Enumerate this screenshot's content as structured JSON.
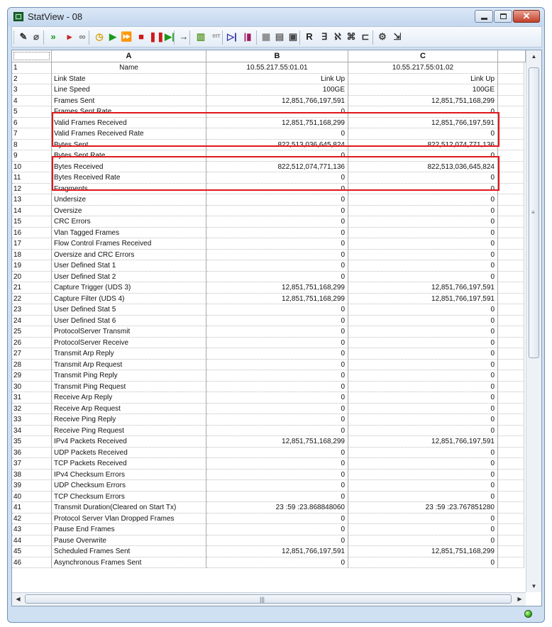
{
  "window": {
    "title": "StatView - 08"
  },
  "colors": {
    "highlight": "#e0181c",
    "status_ok": "#34b01a"
  },
  "toolbar_icons": [
    "pencil-icon",
    "eraser-icon",
    "run-all-icon",
    "play-small-icon",
    "binoculars-icon",
    "clock-icon",
    "play-icon",
    "fast-forward-icon",
    "stop-icon",
    "pause-icon",
    "step-icon",
    "arrow-icon",
    "chart-icon",
    "error-icon",
    "start-capture-icon",
    "stop-capture-icon",
    "grid-icon",
    "properties-icon",
    "properties-edit-icon",
    "reset-icon",
    "link-icon",
    "network-icon",
    "tree-icon",
    "expand-icon",
    "settings-icon",
    "export-icon"
  ],
  "grid": {
    "columns": [
      "A",
      "B",
      "C"
    ],
    "rows": [
      {
        "n": "1",
        "name": "Name",
        "b": "10.55.217.55:01.01",
        "c": "10.55.217.55:01.02"
      },
      {
        "n": "2",
        "name": "Link State",
        "b": "Link Up",
        "c": "Link Up"
      },
      {
        "n": "3",
        "name": "Line Speed",
        "b": "100GE",
        "c": "100GE"
      },
      {
        "n": "4",
        "name": "Frames Sent",
        "b": "12,851,766,197,591",
        "c": "12,851,751,168,299"
      },
      {
        "n": "5",
        "name": "Frames Sent Rate",
        "b": "0",
        "c": "0"
      },
      {
        "n": "6",
        "name": "Valid Frames Received",
        "b": "12,851,751,168,299",
        "c": "12,851,766,197,591"
      },
      {
        "n": "7",
        "name": "Valid Frames Received Rate",
        "b": "0",
        "c": "0"
      },
      {
        "n": "8",
        "name": "Bytes Sent",
        "b": "822,513,036,645,824",
        "c": "822,512,074,771,136"
      },
      {
        "n": "9",
        "name": "Bytes Sent Rate",
        "b": "0",
        "c": "0"
      },
      {
        "n": "10",
        "name": "Bytes Received",
        "b": "822,512,074,771,136",
        "c": "822,513,036,645,824"
      },
      {
        "n": "11",
        "name": "Bytes Received Rate",
        "b": "0",
        "c": "0"
      },
      {
        "n": "12",
        "name": "Fragments",
        "b": "0",
        "c": "0"
      },
      {
        "n": "13",
        "name": "Undersize",
        "b": "0",
        "c": "0"
      },
      {
        "n": "14",
        "name": "Oversize",
        "b": "0",
        "c": "0"
      },
      {
        "n": "15",
        "name": "CRC Errors",
        "b": "0",
        "c": "0"
      },
      {
        "n": "16",
        "name": "Vlan Tagged Frames",
        "b": "0",
        "c": "0"
      },
      {
        "n": "17",
        "name": "Flow Control Frames Received",
        "b": "0",
        "c": "0"
      },
      {
        "n": "18",
        "name": "Oversize and CRC Errors",
        "b": "0",
        "c": "0"
      },
      {
        "n": "19",
        "name": "User Defined Stat 1",
        "b": "0",
        "c": "0"
      },
      {
        "n": "20",
        "name": "User Defined Stat 2",
        "b": "0",
        "c": "0"
      },
      {
        "n": "21",
        "name": "Capture Trigger (UDS 3)",
        "b": "12,851,751,168,299",
        "c": "12,851,766,197,591"
      },
      {
        "n": "22",
        "name": "Capture Filter (UDS 4)",
        "b": "12,851,751,168,299",
        "c": "12,851,766,197,591"
      },
      {
        "n": "23",
        "name": "User Defined Stat 5",
        "b": "0",
        "c": "0"
      },
      {
        "n": "24",
        "name": "User Defined Stat 6",
        "b": "0",
        "c": "0"
      },
      {
        "n": "25",
        "name": "ProtocolServer Transmit",
        "b": "0",
        "c": "0"
      },
      {
        "n": "26",
        "name": "ProtocolServer Receive",
        "b": "0",
        "c": "0"
      },
      {
        "n": "27",
        "name": "Transmit Arp Reply",
        "b": "0",
        "c": "0"
      },
      {
        "n": "28",
        "name": "Transmit Arp Request",
        "b": "0",
        "c": "0"
      },
      {
        "n": "29",
        "name": "Transmit Ping Reply",
        "b": "0",
        "c": "0"
      },
      {
        "n": "30",
        "name": "Transmit Ping Request",
        "b": "0",
        "c": "0"
      },
      {
        "n": "31",
        "name": "Receive Arp Reply",
        "b": "0",
        "c": "0"
      },
      {
        "n": "32",
        "name": "Receive Arp Request",
        "b": "0",
        "c": "0"
      },
      {
        "n": "33",
        "name": "Receive Ping Reply",
        "b": "0",
        "c": "0"
      },
      {
        "n": "34",
        "name": "Receive Ping Request",
        "b": "0",
        "c": "0"
      },
      {
        "n": "35",
        "name": "IPv4 Packets Received",
        "b": "12,851,751,168,299",
        "c": "12,851,766,197,591"
      },
      {
        "n": "36",
        "name": "UDP Packets Received",
        "b": "0",
        "c": "0"
      },
      {
        "n": "37",
        "name": "TCP Packets Received",
        "b": "0",
        "c": "0"
      },
      {
        "n": "38",
        "name": "IPv4 Checksum Errors",
        "b": "0",
        "c": "0"
      },
      {
        "n": "39",
        "name": "UDP Checksum Errors",
        "b": "0",
        "c": "0"
      },
      {
        "n": "40",
        "name": "TCP Checksum Errors",
        "b": "0",
        "c": "0"
      },
      {
        "n": "41",
        "name": "Transmit Duration(Cleared on Start Tx)",
        "b": "23 :59 :23.868848060",
        "c": "23 :59 :23.767851280"
      },
      {
        "n": "42",
        "name": "Protocol Server Vlan Dropped Frames",
        "b": "0",
        "c": "0"
      },
      {
        "n": "43",
        "name": "Pause End Frames",
        "b": "0",
        "c": "0"
      },
      {
        "n": "44",
        "name": "Pause Overwrite",
        "b": "0",
        "c": "0"
      },
      {
        "n": "45",
        "name": "Scheduled Frames Sent",
        "b": "12,851,766,197,591",
        "c": "12,851,751,168,299"
      },
      {
        "n": "46",
        "name": "Asynchronous Frames Sent",
        "b": "0",
        "c": "0"
      }
    ]
  }
}
